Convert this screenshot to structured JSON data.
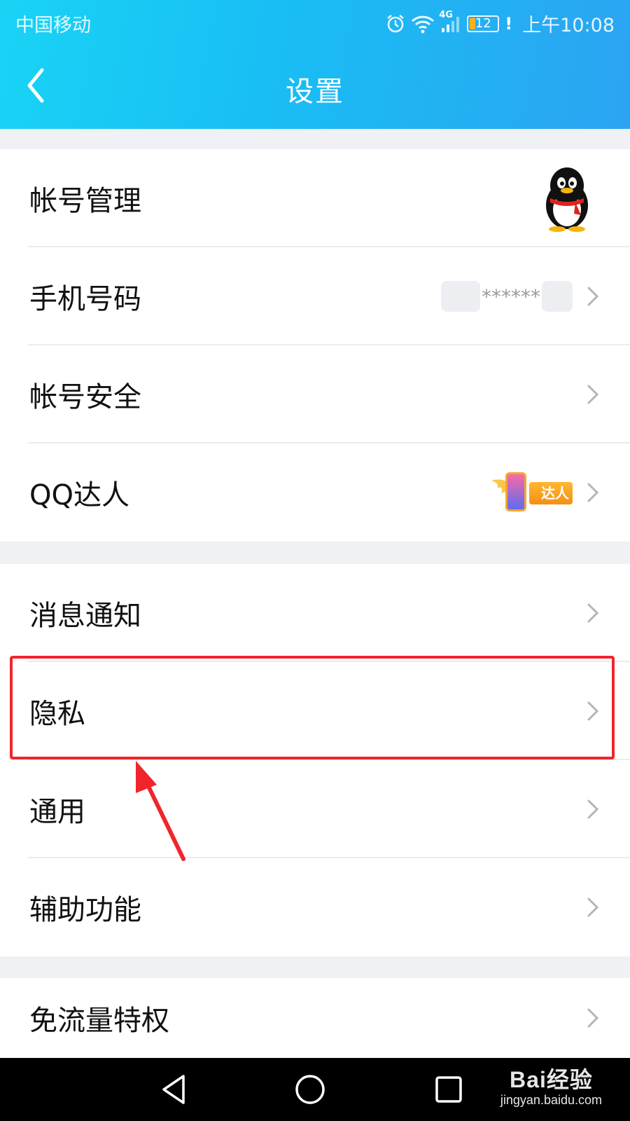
{
  "status_bar": {
    "carrier": "中国移动",
    "network": "4G",
    "battery": "12",
    "time": "上午10:08"
  },
  "header": {
    "title": "设置"
  },
  "groups": [
    {
      "items": [
        {
          "label": "帐号管理",
          "accessory": "avatar"
        },
        {
          "label": "手机号码",
          "value": "******"
        },
        {
          "label": "帐号安全"
        },
        {
          "label": "QQ达人",
          "badge": "达人"
        }
      ]
    },
    {
      "items": [
        {
          "label": "消息通知"
        },
        {
          "label": "隐私"
        },
        {
          "label": "通用"
        },
        {
          "label": "辅助功能"
        }
      ]
    },
    {
      "items": [
        {
          "label": "免流量特权"
        }
      ]
    }
  ],
  "annotation": {
    "highlighted_item": "隐私",
    "color": "#f0252c"
  },
  "watermark": {
    "main": "Bai经验",
    "sub": "jingyan.baidu.com"
  },
  "colors": {
    "header_gradient_start": "#19d3f5",
    "header_gradient_end": "#2ca4f2",
    "background": "#f0f1f5"
  }
}
